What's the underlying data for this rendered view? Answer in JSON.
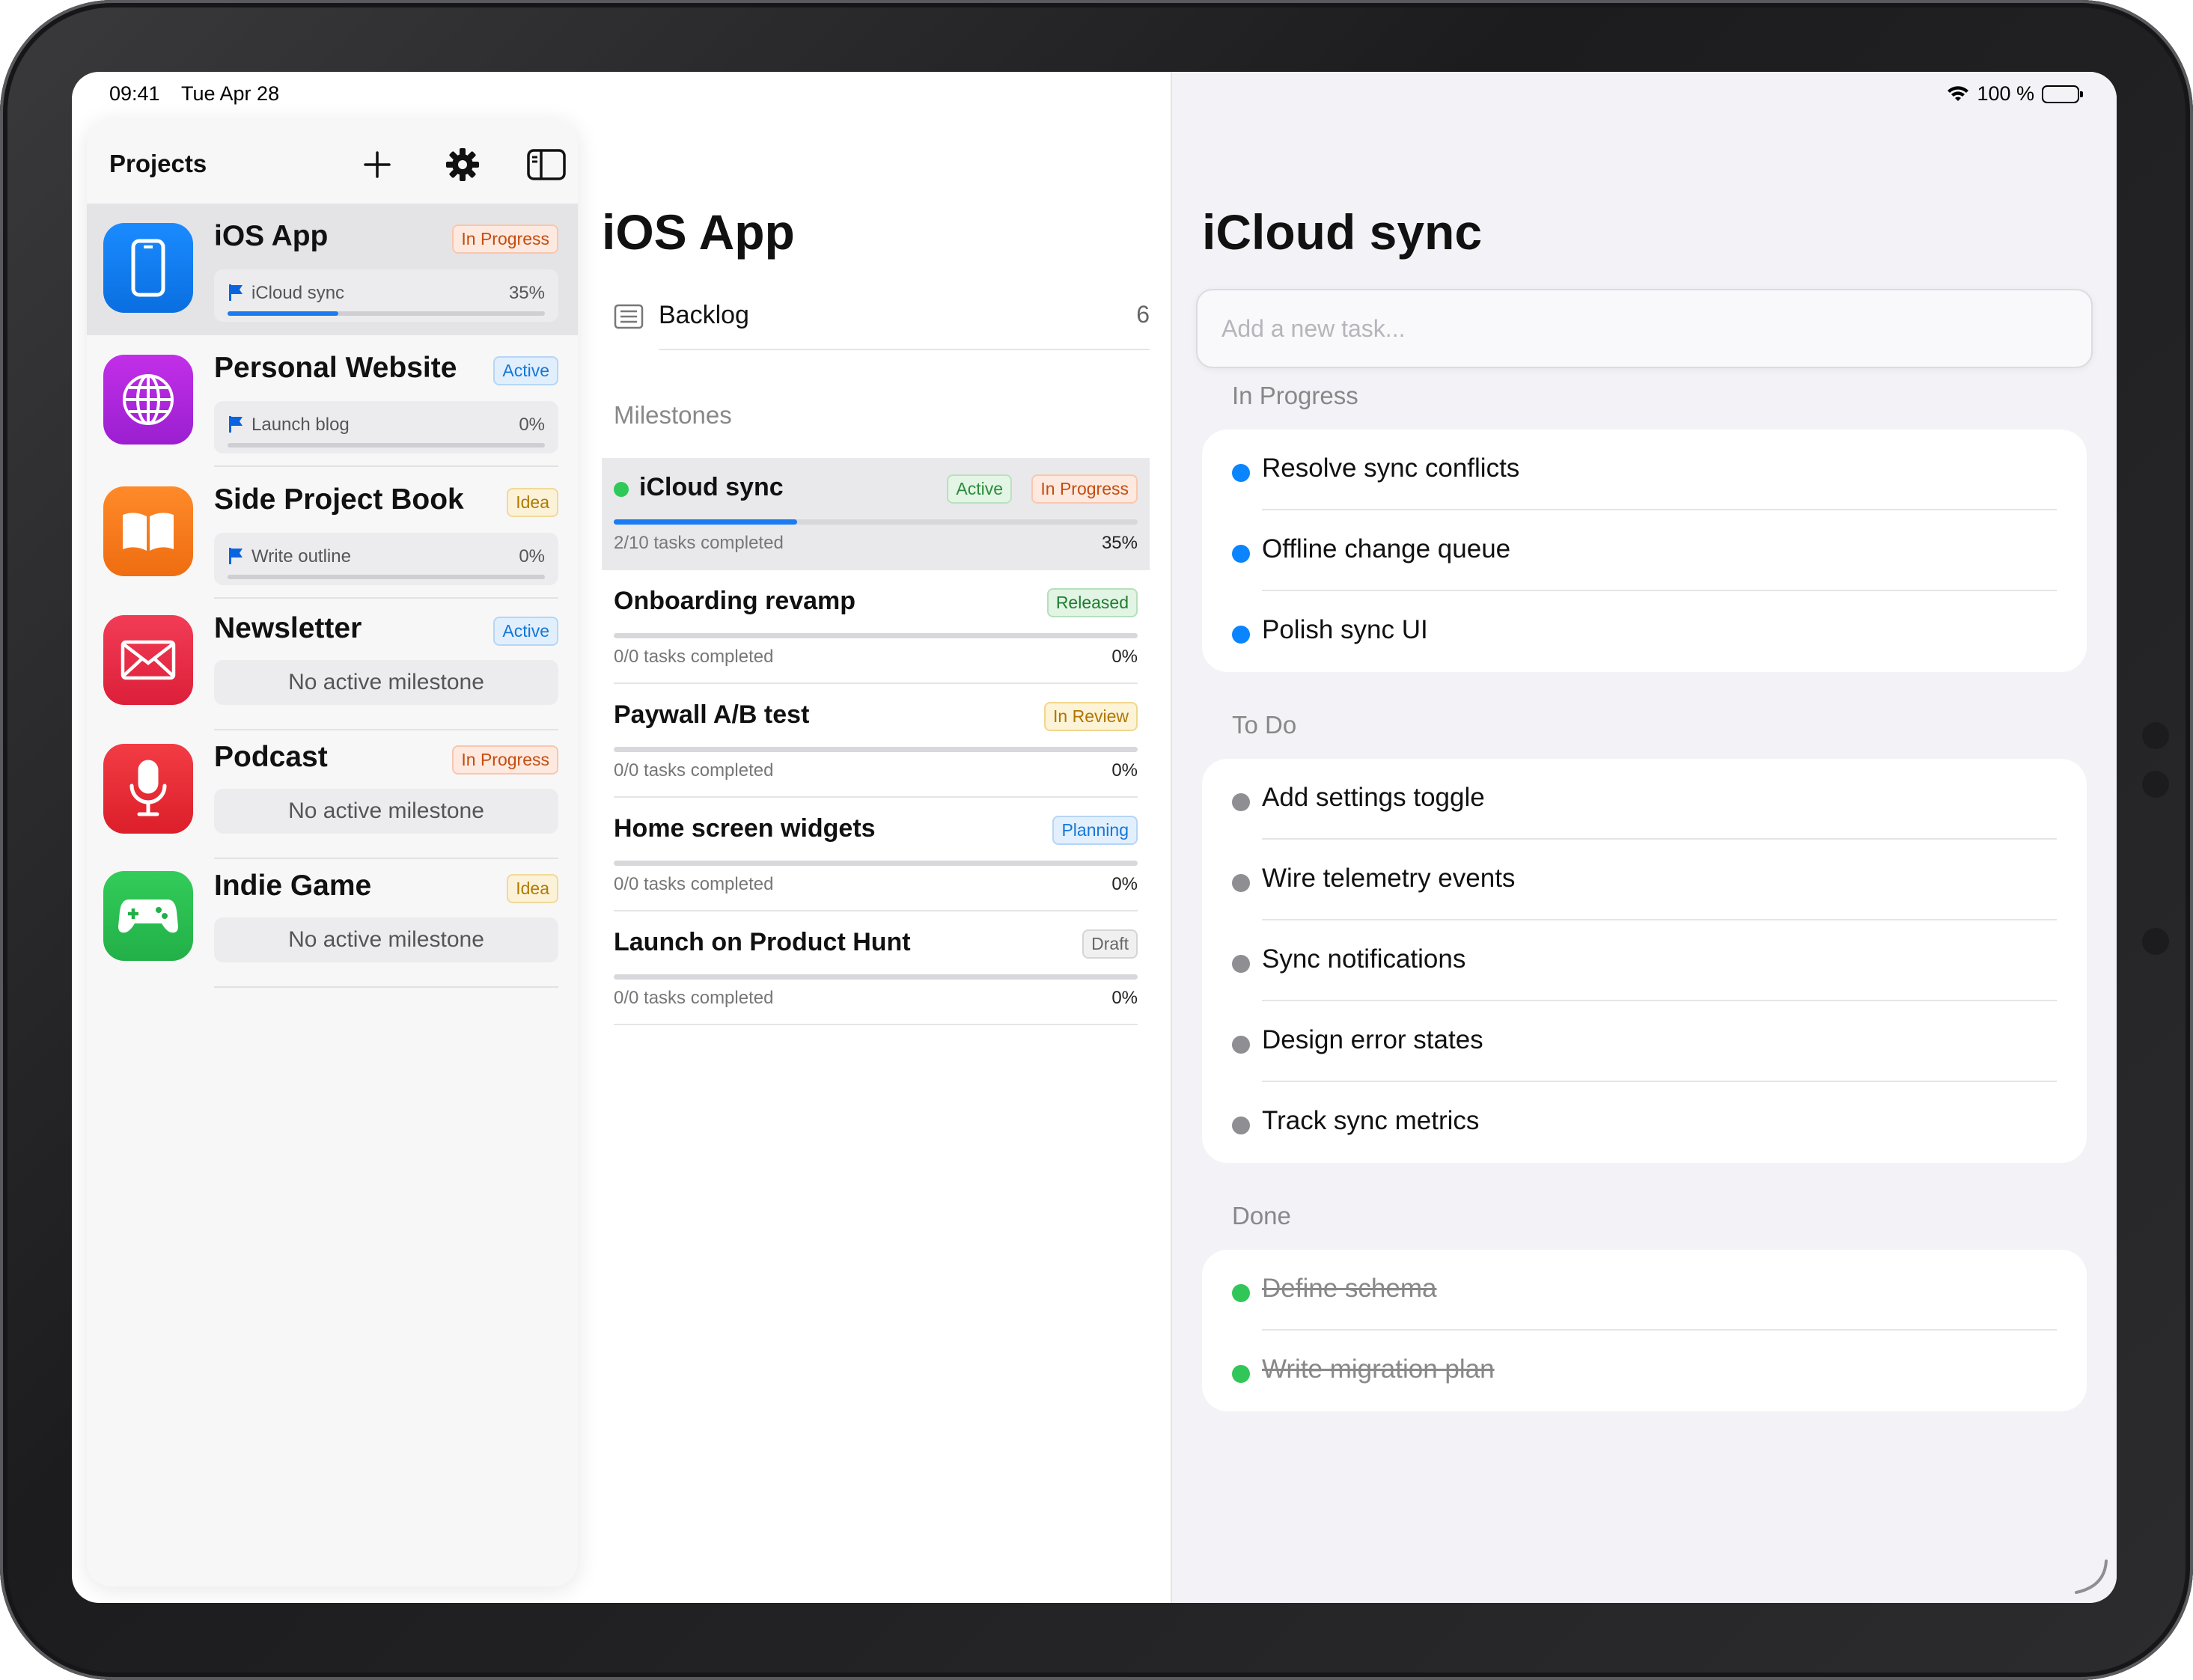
{
  "status": {
    "time": "09:41",
    "date": "Tue Apr 28",
    "battery": "100 %"
  },
  "sidebar": {
    "title": "Projects",
    "projects": [
      {
        "name": "iOS App",
        "badge": "In Progress",
        "milestone": "iCloud sync",
        "pct": "35%",
        "progress": 0.35,
        "selected": true
      },
      {
        "name": "Personal Website",
        "badge": "Active",
        "milestone": "Launch blog",
        "pct": "0%",
        "progress": 0
      },
      {
        "name": "Side Project Book",
        "badge": "Idea",
        "milestone": "Write outline",
        "pct": "0%",
        "progress": 0
      },
      {
        "name": "Newsletter",
        "badge": "Active",
        "empty": "No active milestone"
      },
      {
        "name": "Podcast",
        "badge": "In Progress",
        "empty": "No active milestone"
      },
      {
        "name": "Indie Game",
        "badge": "Idea",
        "empty": "No active milestone"
      }
    ]
  },
  "middle": {
    "title": "iOS App",
    "backlog_label": "Backlog",
    "backlog_count": "6",
    "milestones_header": "Milestones",
    "milestones": [
      {
        "name": "iCloud sync",
        "badge1": "Active",
        "badge2": "In Progress",
        "meta": "2/10 tasks completed",
        "pct": "35%",
        "progress": 0.35
      },
      {
        "name": "Onboarding revamp",
        "badge1": "Released",
        "meta": "0/0 tasks completed",
        "pct": "0%",
        "progress": 0
      },
      {
        "name": "Paywall A/B test",
        "badge1": "In Review",
        "meta": "0/0 tasks completed",
        "pct": "0%",
        "progress": 0
      },
      {
        "name": "Home screen widgets",
        "badge1": "Planning",
        "meta": "0/0 tasks completed",
        "pct": "0%",
        "progress": 0
      },
      {
        "name": "Launch on Product Hunt",
        "badge1": "Draft",
        "meta": "0/0 tasks completed",
        "pct": "0%",
        "progress": 0
      }
    ]
  },
  "detail": {
    "title": "iCloud sync",
    "input_placeholder": "Add a new task...",
    "in_progress_header": "In Progress",
    "in_progress": [
      "Resolve sync conflicts",
      "Offline change queue",
      "Polish sync UI"
    ],
    "todo_header": "To Do",
    "todo": [
      "Add settings toggle",
      "Wire telemetry events",
      "Sync notifications",
      "Design error states",
      "Track sync metrics"
    ],
    "done_header": "Done",
    "done": [
      "Define schema",
      "Write migration plan"
    ]
  },
  "colors": {
    "accent": "#0a84ff",
    "done": "#30c758",
    "todo": "#8e8e93"
  }
}
